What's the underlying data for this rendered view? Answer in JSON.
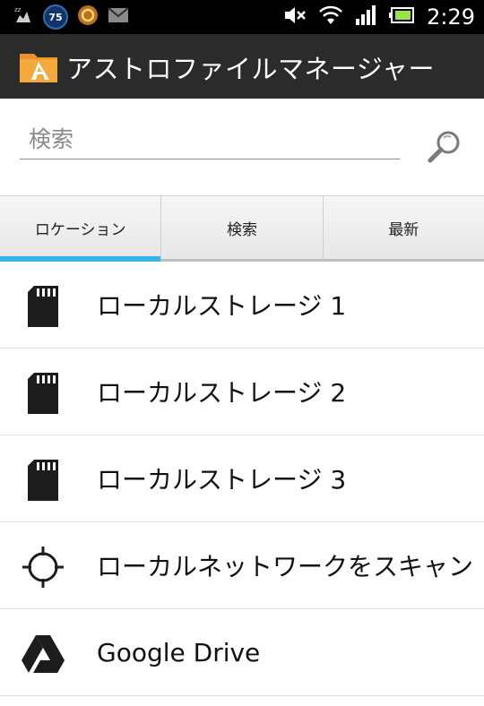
{
  "status_bar": {
    "time": "2:29",
    "badge": "75",
    "icons": [
      "debug-icon",
      "badge-75-icon",
      "sync-icon",
      "mail-icon",
      "mute-icon",
      "wifi-icon",
      "signal-icon",
      "battery-icon"
    ]
  },
  "app": {
    "title": "アストロファイルマネージャー",
    "icon": "astro-folder-icon"
  },
  "search": {
    "placeholder": "検索",
    "value": "",
    "icon": "search-icon"
  },
  "tabs": [
    {
      "label": "ロケーション",
      "active": true
    },
    {
      "label": "検索",
      "active": false
    },
    {
      "label": "最新",
      "active": false
    }
  ],
  "colors": {
    "accent": "#33b5e5",
    "action_bar": "#2b2b2b",
    "status_bar": "#000000"
  },
  "locations": [
    {
      "label": "ローカルストレージ 1",
      "icon": "sd-card-icon"
    },
    {
      "label": "ローカルストレージ 2",
      "icon": "sd-card-icon"
    },
    {
      "label": "ローカルストレージ 3",
      "icon": "sd-card-icon"
    },
    {
      "label": "ローカルネットワークをスキャン",
      "icon": "crosshair-icon"
    },
    {
      "label": "Google Drive",
      "icon": "google-drive-icon"
    }
  ]
}
